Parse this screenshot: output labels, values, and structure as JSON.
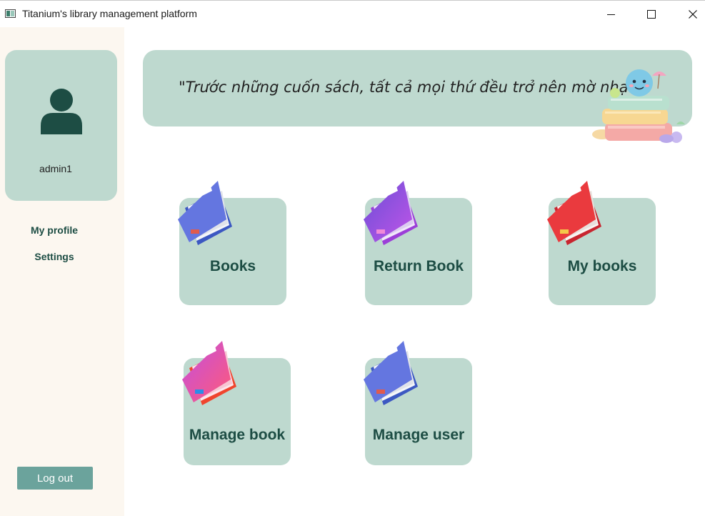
{
  "window": {
    "title": "Titanium's library management platform",
    "controls": [
      "minimize",
      "maximize",
      "close"
    ]
  },
  "sidebar": {
    "username": "admin1",
    "links": [
      {
        "label": "My profile"
      },
      {
        "label": "Settings"
      }
    ],
    "logout_label": "Log out"
  },
  "banner": {
    "quote": "\"Trước những cuốn sách, tất cả mọi thứ đều trở nên mờ nhạt.\""
  },
  "tiles": [
    {
      "label": "Books",
      "icon": "blue-book-icon"
    },
    {
      "label": "Return Book",
      "icon": "purple-book-icon"
    },
    {
      "label": "My books",
      "icon": "red-book-icon"
    },
    {
      "label": "Manage book",
      "icon": "pink-book-icon"
    },
    {
      "label": "Manage user",
      "icon": "blue-book-icon"
    }
  ],
  "colors": {
    "card_bg": "#bed9cf",
    "sidebar_bg": "#fcf7f0",
    "accent_text": "#1d4d44",
    "logout_bg": "#6ba39c"
  }
}
